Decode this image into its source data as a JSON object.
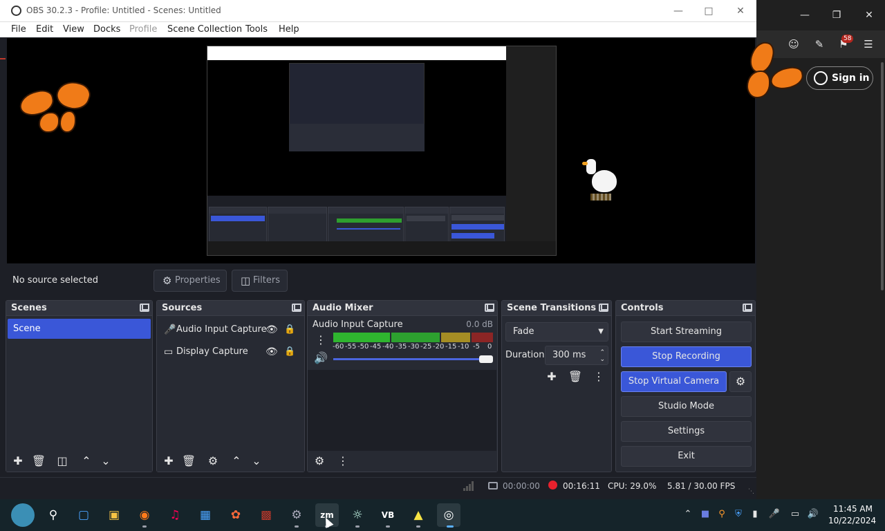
{
  "window": {
    "title": "OBS 30.2.3 - Profile: Untitled - Scenes: Untitled"
  },
  "menu": {
    "file": "File",
    "edit": "Edit",
    "view": "View",
    "docks": "Docks",
    "profile": "Profile",
    "scene_collection": "Scene Collection",
    "tools": "Tools",
    "help": "Help"
  },
  "info_bar": {
    "no_source": "No source selected",
    "properties": "Properties",
    "filters": "Filters"
  },
  "scenes": {
    "title": "Scenes",
    "items": [
      {
        "label": "Scene",
        "selected": true
      }
    ]
  },
  "sources": {
    "title": "Sources",
    "items": [
      {
        "label": "Audio Input Capture",
        "icon": "microphone-icon"
      },
      {
        "label": "Display Capture",
        "icon": "monitor-icon"
      }
    ]
  },
  "audio_mixer": {
    "title": "Audio Mixer",
    "channel": {
      "name": "Audio Input Capture",
      "db": "0.0 dB",
      "volume": 1.0
    },
    "ticks": [
      "-60",
      "-55",
      "-50",
      "-45",
      "-40",
      "-35",
      "-30",
      "-25",
      "-20",
      "-15",
      "-10",
      "-5",
      "0"
    ]
  },
  "scene_transitions": {
    "title": "Scene Transitions",
    "transition": "Fade",
    "duration_label": "Duration",
    "duration": "300 ms"
  },
  "controls": {
    "title": "Controls",
    "start_streaming": "Start Streaming",
    "stop_recording": "Stop Recording",
    "stop_virtual_camera": "Stop Virtual Camera",
    "studio_mode": "Studio Mode",
    "settings": "Settings",
    "exit": "Exit"
  },
  "status": {
    "stream_time": "00:00:00",
    "rec_time": "00:16:11",
    "cpu": "CPU: 29.0%",
    "fps": "5.81 / 30.00 FPS"
  },
  "browser": {
    "sign_in": "Sign in",
    "badge": "58"
  },
  "taskbar": {
    "apps": [
      "globe-icon",
      "search-icon",
      "widgets-icon",
      "file-explorer-icon",
      "firefox-icon",
      "music-icon",
      "store-icon",
      "app-icon",
      "archive-icon",
      "settings-icon",
      "zoom-icon",
      "steam-icon",
      "vb-audio-icon",
      "app2-icon",
      "obs-icon"
    ],
    "time": "11:45 AM",
    "date": "10/22/2024"
  },
  "colors": {
    "accent": "#3a57d8",
    "panel": "#272a33",
    "background": "#1d1f26",
    "record": "#e8212d"
  }
}
